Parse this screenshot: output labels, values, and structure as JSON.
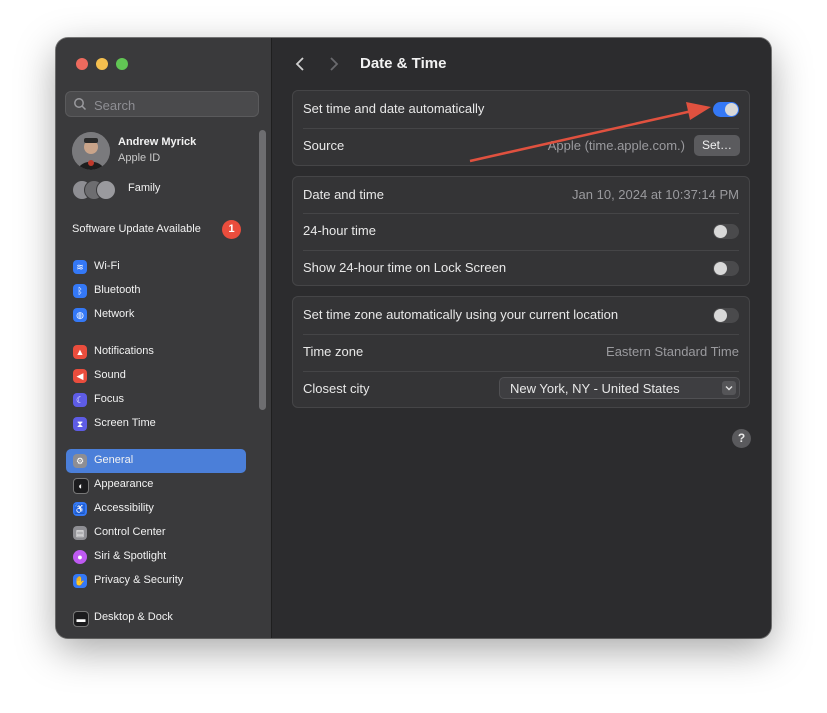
{
  "sidebar": {
    "search_placeholder": "Search",
    "profile": {
      "name": "Andrew Myrick",
      "subtitle": "Apple ID"
    },
    "family_label": "Family",
    "update": {
      "label": "Software Update Available",
      "badge": "1"
    },
    "items": [
      {
        "label": "Wi-Fi",
        "icon": "wifi-icon",
        "color": "#3478f6"
      },
      {
        "label": "Bluetooth",
        "icon": "bluetooth-icon",
        "color": "#3478f6"
      },
      {
        "label": "Network",
        "icon": "network-icon",
        "color": "#3478f6"
      },
      {
        "label": "Notifications",
        "icon": "bell-icon",
        "color": "#ea4d3d"
      },
      {
        "label": "Sound",
        "icon": "speaker-icon",
        "color": "#ea4d3d"
      },
      {
        "label": "Focus",
        "icon": "moon-icon",
        "color": "#5e5ce6"
      },
      {
        "label": "Screen Time",
        "icon": "hourglass-icon",
        "color": "#5e5ce6"
      },
      {
        "label": "General",
        "icon": "gear-icon",
        "color": "#8e8e93"
      },
      {
        "label": "Appearance",
        "icon": "appearance-icon",
        "color": "#1c1c1e"
      },
      {
        "label": "Accessibility",
        "icon": "accessibility-icon",
        "color": "#3478f6"
      },
      {
        "label": "Control Center",
        "icon": "control-center-icon",
        "color": "#8e8e93"
      },
      {
        "label": "Siri & Spotlight",
        "icon": "siri-icon",
        "color": "#bf5af2"
      },
      {
        "label": "Privacy & Security",
        "icon": "hand-icon",
        "color": "#3478f6"
      },
      {
        "label": "Desktop & Dock",
        "icon": "dock-icon",
        "color": "#1c1c1e"
      }
    ]
  },
  "main": {
    "title": "Date & Time",
    "auto_time_label": "Set time and date automatically",
    "auto_time_on": true,
    "source_label": "Source",
    "source_value": "Apple (time.apple.com.)",
    "set_button": "Set…",
    "date_time_label": "Date and time",
    "date_time_value": "Jan 10, 2024 at 10:37:14 PM",
    "hour24_label": "24-hour time",
    "hour24_on": false,
    "lock_screen_label": "Show 24-hour time on Lock Screen",
    "lock_screen_on": false,
    "auto_tz_label": "Set time zone automatically using your current location",
    "auto_tz_on": false,
    "timezone_label": "Time zone",
    "timezone_value": "Eastern Standard Time",
    "city_label": "Closest city",
    "city_value": "New York, NY - United States",
    "help": "?"
  },
  "colors": {
    "accent": "#3478f6",
    "annotation_arrow": "#e0513f",
    "active_item": "#4b7fd9"
  }
}
